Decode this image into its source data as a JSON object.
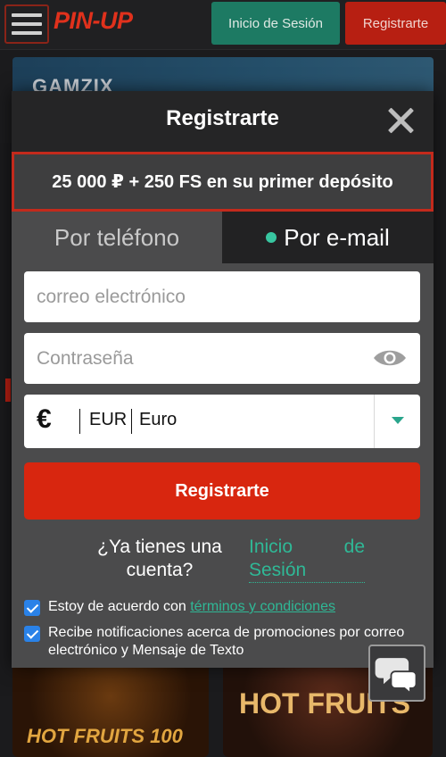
{
  "header": {
    "logo": "PIN-UP",
    "login_label": "Inicio de Sesión",
    "register_label": "Registrarte"
  },
  "background": {
    "banner_text": "GAMZIX",
    "tile_left_text": "HOT FRUITS 100",
    "tile_right_text": "HOT FRUITS"
  },
  "modal": {
    "title": "Registrarte",
    "promo": "25 000 ₽ + 250 FS en su primer depósito",
    "tabs": [
      {
        "label": "Por teléfono",
        "active": false
      },
      {
        "label": "Por e-mail",
        "active": true
      }
    ],
    "email_placeholder": "correo electrónico",
    "password_placeholder": "Contraseña",
    "currency": {
      "symbol": "€",
      "code": "EUR",
      "name": "Euro"
    },
    "submit_label": "Registrarte",
    "have_account": "¿Ya tienes una cuenta?",
    "login_link": "Inicio de Sesión",
    "terms_prefix": "Estoy de acuerdo con ",
    "terms_link": "términos y condiciones",
    "newsletter_text": "Recibe notificaciones acerca de promociones por correo electrónico y Mensaje de Texto"
  },
  "colors": {
    "accent_green": "#2fb896",
    "brand_red": "#d8260f",
    "checkbox_blue": "#2a82e8"
  }
}
